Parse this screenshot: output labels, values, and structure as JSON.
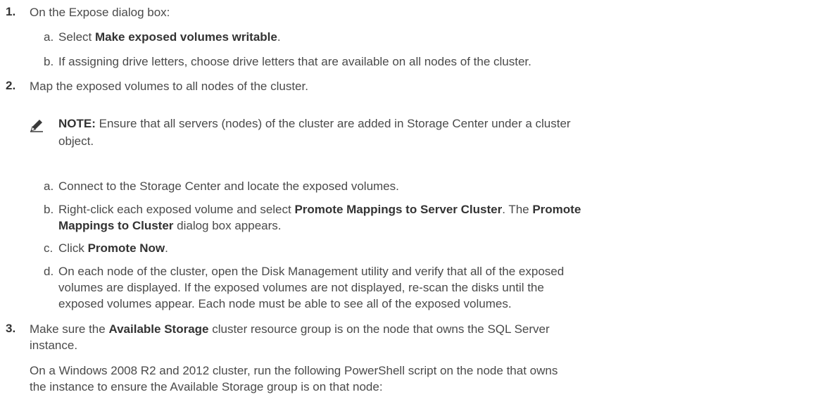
{
  "steps": [
    {
      "number": "1.",
      "text": "On the Expose dialog box:",
      "substeps": [
        {
          "letter": "a.",
          "pre": "Select ",
          "bold": "Make exposed volumes writable",
          "post": "."
        },
        {
          "letter": "b.",
          "text": "If assigning drive letters, choose drive letters that are available on all nodes of the cluster."
        }
      ]
    },
    {
      "number": "2.",
      "text": "Map the exposed volumes to all nodes of the cluster.",
      "note": {
        "icon": "pencil-note-icon",
        "label": "NOTE:",
        "line1": " Ensure that all servers (nodes) of the cluster are added in Storage Center under a cluster",
        "line2": "object."
      },
      "substeps": [
        {
          "letter": "a.",
          "text": "Connect to the Storage Center and locate the exposed volumes."
        },
        {
          "letter": "b.",
          "pre": "Right-click each exposed volume and select ",
          "bold1": "Promote Mappings to Server Cluster",
          "mid": ". The ",
          "bold2": "Promote",
          "line2_bold": "Mappings to Cluster",
          "line2_post": " dialog box appears."
        },
        {
          "letter": "c.",
          "pre": "Click ",
          "bold": "Promote Now",
          "post": "."
        },
        {
          "letter": "d.",
          "line1": "On each node of the cluster, open the Disk Management utility and verify that all of the exposed",
          "line2": "volumes are displayed. If the exposed volumes are not displayed, re-scan the disks until the",
          "line3": "exposed volumes appear. Each node must be able to see all of the exposed volumes."
        }
      ]
    },
    {
      "number": "3.",
      "pre": "Make sure the ",
      "bold": "Available Storage",
      "post": " cluster resource group is on the node that owns the SQL Server",
      "line2": "instance.",
      "para_line1": "On a Windows 2008 R2 and 2012 cluster, run the following PowerShell script on the node that owns",
      "para_line2": "the instance to ensure the Available Storage group is on that node:"
    }
  ]
}
